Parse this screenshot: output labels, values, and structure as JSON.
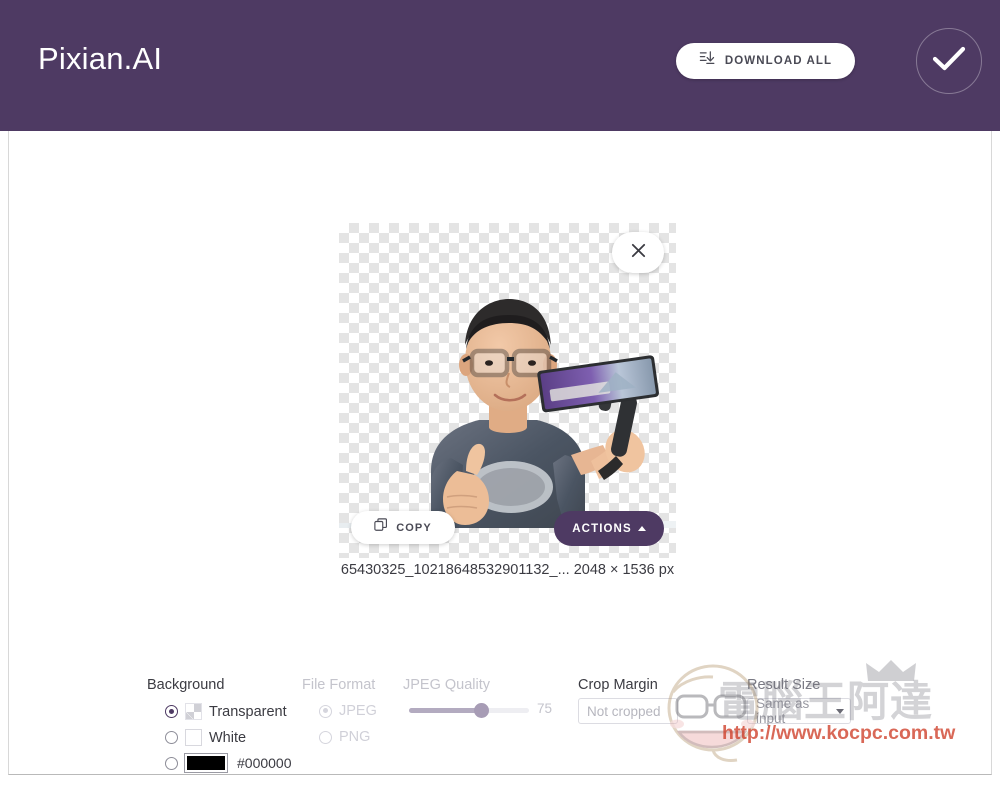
{
  "header": {
    "logo": "Pixian.AI",
    "download_all_label": "DOWNLOAD ALL",
    "download_icon": "download-list-icon",
    "status_icon": "check-icon",
    "background_color": "#4e3a63"
  },
  "result_card": {
    "close_icon": "close-icon",
    "copy_label": "COPY",
    "copy_icon": "copy-icon",
    "actions_label": "ACTIONS",
    "actions_caret": "caret-up-icon",
    "file_name": "65430325_10218648532901132_...",
    "dimensions": "2048 × 1536 px",
    "background": "transparent-checkerboard",
    "photo_alt": "man with glasses giving thumbs up holding a gimbal-mounted phone"
  },
  "controls": {
    "background": {
      "title": "Background",
      "options": [
        {
          "label": "Transparent",
          "selected": true,
          "swatch": "transparent"
        },
        {
          "label": "White",
          "selected": false,
          "swatch": "white"
        },
        {
          "label": "#000000",
          "selected": false,
          "swatch": "black",
          "color": "#000000"
        }
      ]
    },
    "file_format": {
      "title": "File Format",
      "disabled": true,
      "options": [
        {
          "label": "JPEG",
          "selected": true
        },
        {
          "label": "PNG",
          "selected": false
        }
      ]
    },
    "jpeg_quality": {
      "title": "JPEG Quality",
      "disabled": true,
      "value": "75",
      "min": 0,
      "max": 100
    },
    "crop_margin": {
      "title": "Crop Margin",
      "value": "",
      "placeholder": "Not cropped"
    },
    "result_size": {
      "title": "Result Size",
      "value": "Same as input",
      "caret": "caret-down-icon"
    }
  },
  "watermark": {
    "text": "電腦王阿達",
    "url": "http://www.kocpc.com.tw"
  }
}
